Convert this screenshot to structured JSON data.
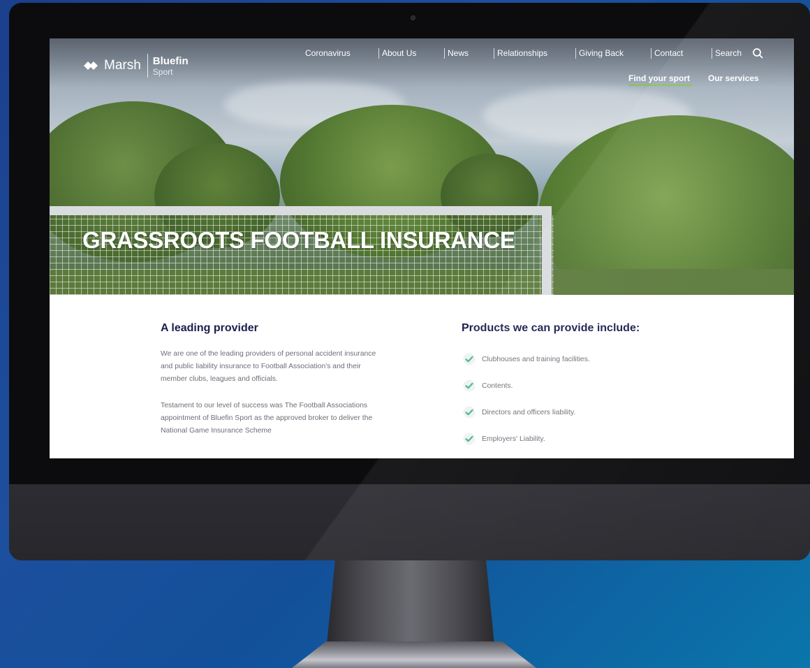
{
  "header": {
    "logo": {
      "marsh": "Marsh",
      "bluefin": "Bluefin",
      "sport": "Sport"
    },
    "nav": [
      "Coronavirus",
      "About Us",
      "News",
      "Relationships",
      "Giving Back",
      "Contact"
    ],
    "search_label": "Search",
    "subnav": {
      "find_sport": "Find your sport",
      "services": "Our services"
    }
  },
  "hero": {
    "title": "GRASSROOTS FOOTBALL INSURANCE"
  },
  "left": {
    "title": "A leading provider",
    "paragraphs": [
      "We are one of the leading providers of personal accident insurance and public liability insurance to Football Association's and their member clubs, leagues and officials.",
      "Testament to our level of success was The Football Associations appointment of Bluefin Sport as the approved broker to deliver the National Game Insurance Scheme"
    ]
  },
  "right": {
    "title": "Products we can provide include:",
    "products": [
      "Clubhouses and training facilities.",
      "Contents.",
      "Directors and officers liability.",
      "Employers' Liability."
    ]
  },
  "colors": {
    "heading": "#1c1f4e",
    "body_text": "#6d6f78",
    "check": "#3fb68b",
    "accent_underline": "#8bc34a"
  },
  "icons": [
    "marsh-logo-icon",
    "search-icon",
    "check-icon"
  ]
}
